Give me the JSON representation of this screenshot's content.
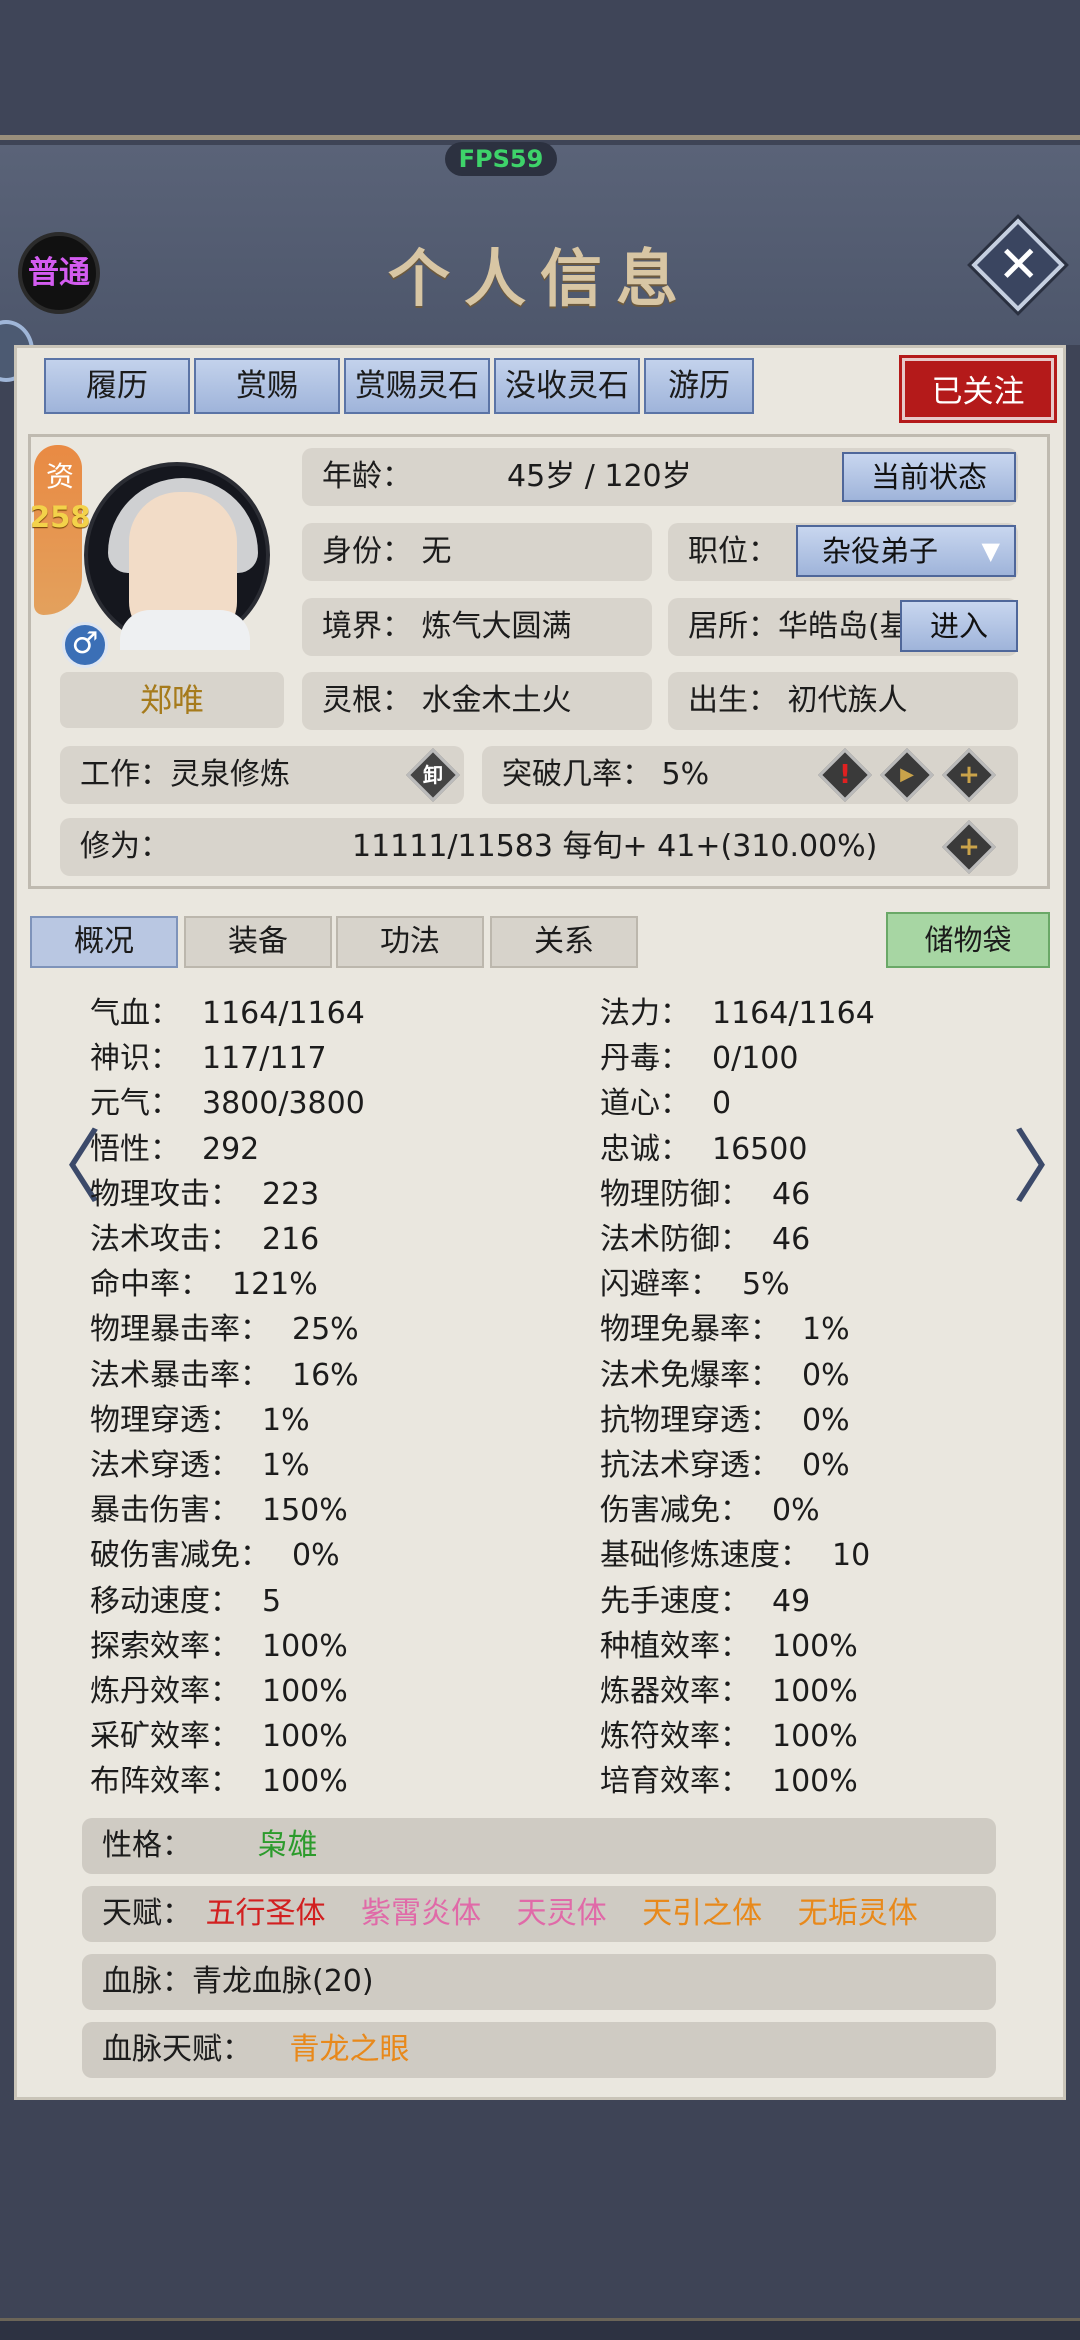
{
  "fps": "FPS59",
  "mode_badge": "普通",
  "title": "个人信息",
  "close_icon": "close-icon",
  "top_tabs": [
    {
      "label": "履历"
    },
    {
      "label": "赏赐"
    },
    {
      "label": "赏赐灵石"
    },
    {
      "label": "没收灵石"
    },
    {
      "label": "游历"
    }
  ],
  "follow_button": "已关注",
  "character": {
    "talent_label": "资",
    "talent_value": "258",
    "gender_icon": "male-icon",
    "gender_symbol": "♂",
    "name": "郑唯",
    "age_label": "年龄：",
    "age_value": "45岁 / 120岁",
    "status_button": "当前状态",
    "identity": "身份：  无",
    "position_label": "职位：",
    "position_value": "杂役弟子",
    "realm": "境界：  炼气大圆满",
    "residence": "居所：华皓岛(基",
    "enter_button": "进入",
    "spirit_root": "灵根：  水金木土火",
    "birth": "出生：  初代族人",
    "job": "工作：灵泉修炼",
    "unequip_icon_label": "卸",
    "breakthrough": "突破几率：  5%",
    "cultivation_label": "修为：",
    "cultivation_value": "11111/11583  每旬+  41+(310.00%)"
  },
  "sub_tabs": [
    {
      "label": "概况"
    },
    {
      "label": "装备"
    },
    {
      "label": "功法"
    },
    {
      "label": "关系"
    }
  ],
  "storage_button": "储物袋",
  "stats_left": [
    {
      "label": "气血：",
      "value": "1164/1164"
    },
    {
      "label": "神识：",
      "value": "117/117"
    },
    {
      "label": "元气：",
      "value": "3800/3800"
    },
    {
      "label": "悟性：",
      "value": "292"
    },
    {
      "label": "物理攻击：",
      "value": "223"
    },
    {
      "label": "法术攻击：",
      "value": "216"
    },
    {
      "label": "命中率：",
      "value": "121%"
    },
    {
      "label": "物理暴击率：",
      "value": "25%"
    },
    {
      "label": "法术暴击率：",
      "value": "16%"
    },
    {
      "label": "物理穿透：",
      "value": "1%"
    },
    {
      "label": "法术穿透：",
      "value": "1%"
    },
    {
      "label": "暴击伤害：",
      "value": "150%"
    },
    {
      "label": "破伤害减免：",
      "value": "0%"
    },
    {
      "label": "移动速度：",
      "value": "5"
    },
    {
      "label": "探索效率：",
      "value": "100%"
    },
    {
      "label": "炼丹效率：",
      "value": "100%"
    },
    {
      "label": "采矿效率：",
      "value": "100%"
    },
    {
      "label": "布阵效率：",
      "value": "100%"
    }
  ],
  "stats_right": [
    {
      "label": "法力：",
      "value": "1164/1164"
    },
    {
      "label": "丹毒：",
      "value": "0/100"
    },
    {
      "label": "道心：",
      "value": "0"
    },
    {
      "label": "忠诚：",
      "value": "16500"
    },
    {
      "label": "物理防御：",
      "value": "46"
    },
    {
      "label": "法术防御：",
      "value": "46"
    },
    {
      "label": "闪避率：",
      "value": "5%"
    },
    {
      "label": "物理免暴率：",
      "value": "1%"
    },
    {
      "label": "法术免爆率：",
      "value": "0%"
    },
    {
      "label": "抗物理穿透：",
      "value": "0%"
    },
    {
      "label": "抗法术穿透：",
      "value": "0%"
    },
    {
      "label": "伤害减免：",
      "value": "0%"
    },
    {
      "label": "基础修炼速度：",
      "value": "10"
    },
    {
      "label": "先手速度：",
      "value": "49"
    },
    {
      "label": "种植效率：",
      "value": "100%"
    },
    {
      "label": "炼器效率：",
      "value": "100%"
    },
    {
      "label": "炼符效率：",
      "value": "100%"
    },
    {
      "label": "培育效率：",
      "value": "100%"
    }
  ],
  "personality": {
    "label": "性格：",
    "value": "枭雄",
    "color": "#2c9b2c"
  },
  "talents": {
    "label": "天赋：",
    "items": [
      {
        "name": "五行圣体",
        "color": "#d22020"
      },
      {
        "name": "紫霄炎体",
        "color": "#e06aa8"
      },
      {
        "name": "天灵体",
        "color": "#e06aa8"
      },
      {
        "name": "天引之体",
        "color": "#e8891b"
      },
      {
        "name": "无垢灵体",
        "color": "#e8891b"
      }
    ]
  },
  "bloodline": "血脉：青龙血脉(20)",
  "bloodline_talent": {
    "label": "血脉天赋：",
    "value": "青龙之眼",
    "color": "#e8891b"
  },
  "icons": {
    "warning": "!",
    "play": "▶",
    "plus": "+",
    "left_arrow": "〈",
    "right_arrow": "〉"
  }
}
